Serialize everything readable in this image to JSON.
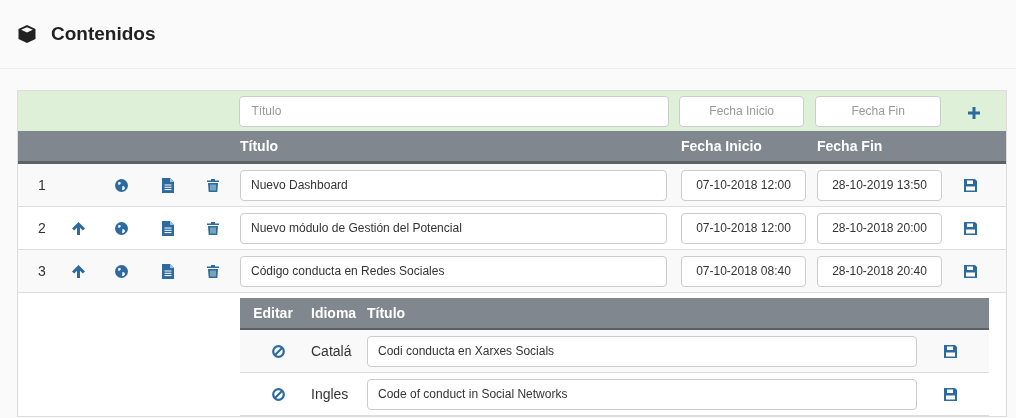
{
  "header": {
    "title": "Contenidos"
  },
  "filter": {
    "title_placeholder": "Título",
    "start_placeholder": "Fecha Inicio",
    "end_placeholder": "Fecha Fin"
  },
  "columns": [
    "Título",
    "Fecha Inicio",
    "Fecha Fin"
  ],
  "rows": [
    {
      "number": "1",
      "movable_up": false,
      "title": "Nuevo Dashboard",
      "start": "07-10-2018 12:00",
      "end": "28-10-2019 13:50"
    },
    {
      "number": "2",
      "movable_up": true,
      "title": "Nuevo módulo de Gestión del Potencial",
      "start": "07-10-2018 12:00",
      "end": "28-10-2018 20:00"
    },
    {
      "number": "3",
      "movable_up": true,
      "title": "Código conducta en Redes Sociales",
      "start": "07-10-2018 08:40",
      "end": "28-10-2018 20:40",
      "translations": {
        "columns": [
          "Editar",
          "Idioma",
          "Título"
        ],
        "rows": [
          {
            "language": "Catalá",
            "title": "Codi conducta en Xarxes Socials"
          },
          {
            "language": "Ingles",
            "title": "Code of conduct in Social Networks"
          }
        ]
      }
    }
  ]
}
